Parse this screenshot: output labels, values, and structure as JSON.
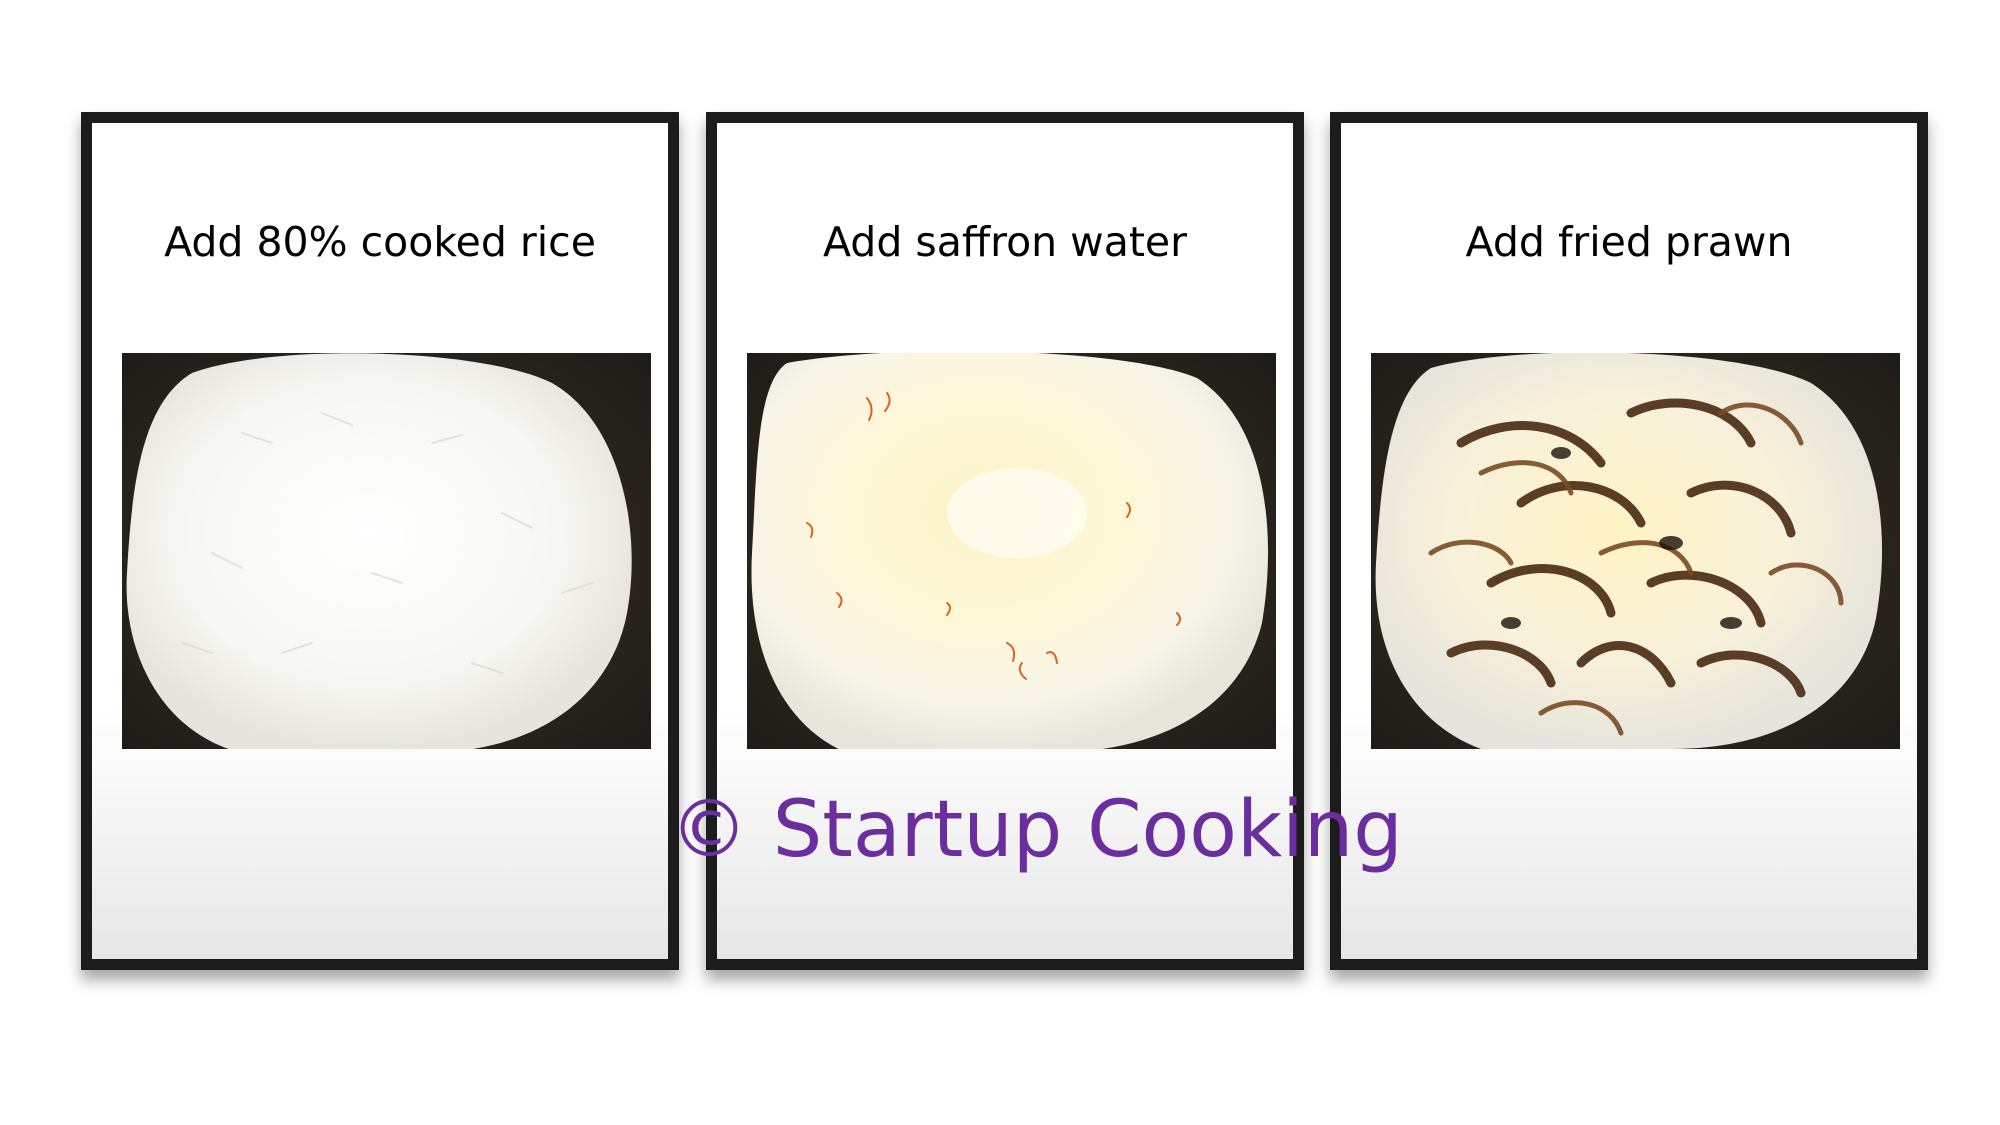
{
  "steps": [
    {
      "caption": "Add 80% cooked rice",
      "photo": "cooked-rice-in-pan"
    },
    {
      "caption": "Add saffron water",
      "photo": "rice-with-saffron-strands"
    },
    {
      "caption": "Add fried prawn",
      "photo": "rice-topped-with-fried-onions"
    }
  ],
  "watermark": "© Startup Cooking",
  "colors": {
    "frame": "#1c1c1c",
    "watermark": "#6a2e9e",
    "pan": "#2b2722"
  }
}
